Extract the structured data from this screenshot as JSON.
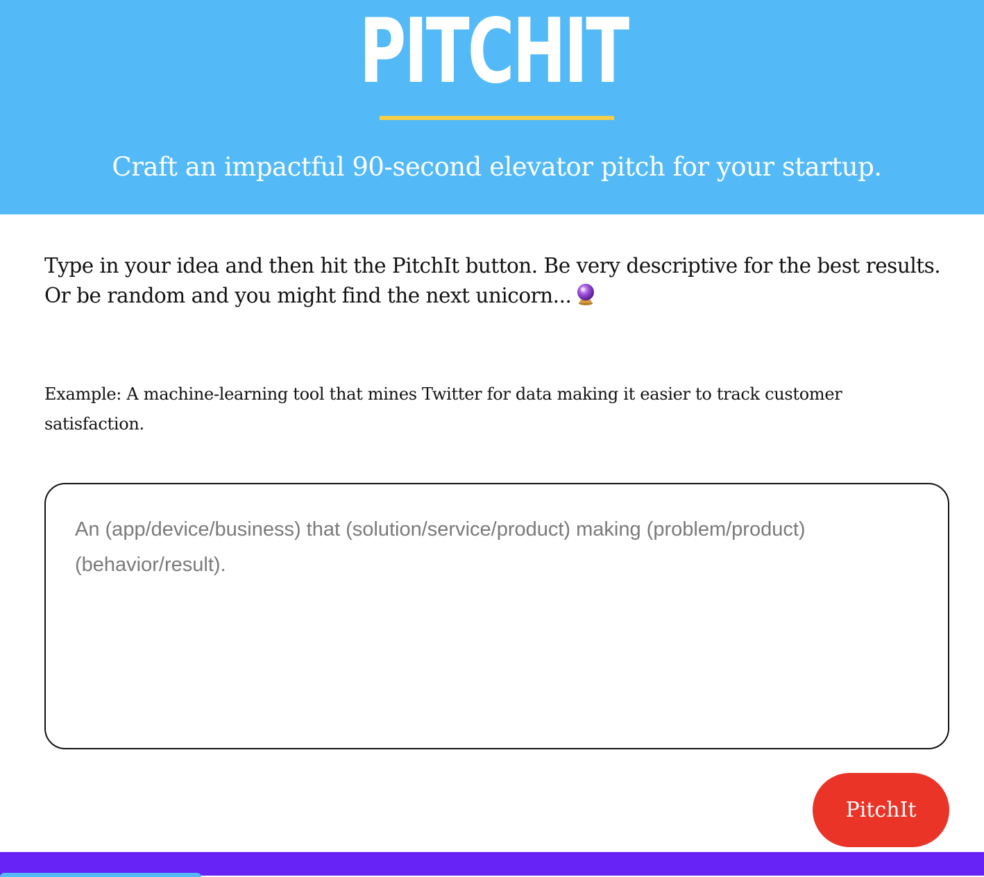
{
  "header": {
    "logo": "PITCHIT",
    "tagline": "Craft an impactful 90-second elevator pitch for your startup."
  },
  "intro": {
    "text": "Type in your idea and then hit the PitchIt button. Be very descriptive for the best results. Or be random and you might find the next unicorn...",
    "icon": "crystal-ball-icon"
  },
  "example": {
    "text": "Example: A machine-learning tool that mines Twitter for data making it easier to track customer satisfaction."
  },
  "idea_input": {
    "value": "",
    "placeholder": "An (app/device/business) that (solution/service/product) making (problem/product) (behavior/result)."
  },
  "actions": {
    "pitch_label": "PitchIt"
  },
  "colors": {
    "header_bg": "#53baf7",
    "underline": "#f5cf47",
    "button_bg": "#e93427",
    "footer_bg": "#6722f5"
  }
}
